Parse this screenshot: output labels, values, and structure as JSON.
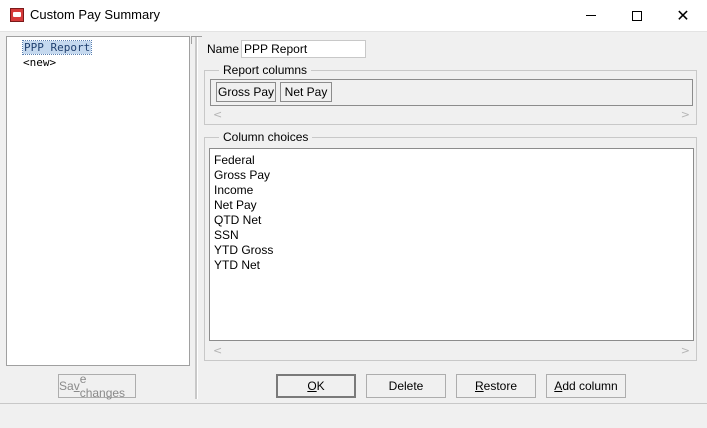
{
  "window": {
    "title": "Custom Pay Summary",
    "close_glyph": "✕"
  },
  "left_list": {
    "items": [
      {
        "label": "PPP Report",
        "selected": true
      },
      {
        "label": "<new>",
        "selected": false
      }
    ]
  },
  "buttons": {
    "save_changes": {
      "mnemonic": "v",
      "rest": "e changes",
      "prefix": "Sa"
    },
    "ok": {
      "mnemonic": "O",
      "rest": "K"
    },
    "delete": {
      "mnemonic": "",
      "rest": "Delete"
    },
    "restore": {
      "mnemonic": "R",
      "rest": "estore"
    },
    "add_column": {
      "mnemonic": "A",
      "rest": "dd column"
    }
  },
  "name_field": {
    "label": "Name",
    "value": "PPP Report"
  },
  "report_columns": {
    "legend": "Report columns",
    "columns": [
      "Gross Pay",
      "Net Pay"
    ],
    "scroll_left": "<",
    "scroll_right": ">"
  },
  "column_choices": {
    "legend": "Column choices",
    "items": [
      "Federal",
      "Gross Pay",
      "Income",
      "Net Pay",
      "QTD Net",
      "SSN",
      "YTD Gross",
      "YTD Net"
    ],
    "scroll_left": "<",
    "scroll_right": ">"
  },
  "icons": [
    "app-icon",
    "minimize-icon",
    "maximize-icon",
    "close-icon"
  ]
}
